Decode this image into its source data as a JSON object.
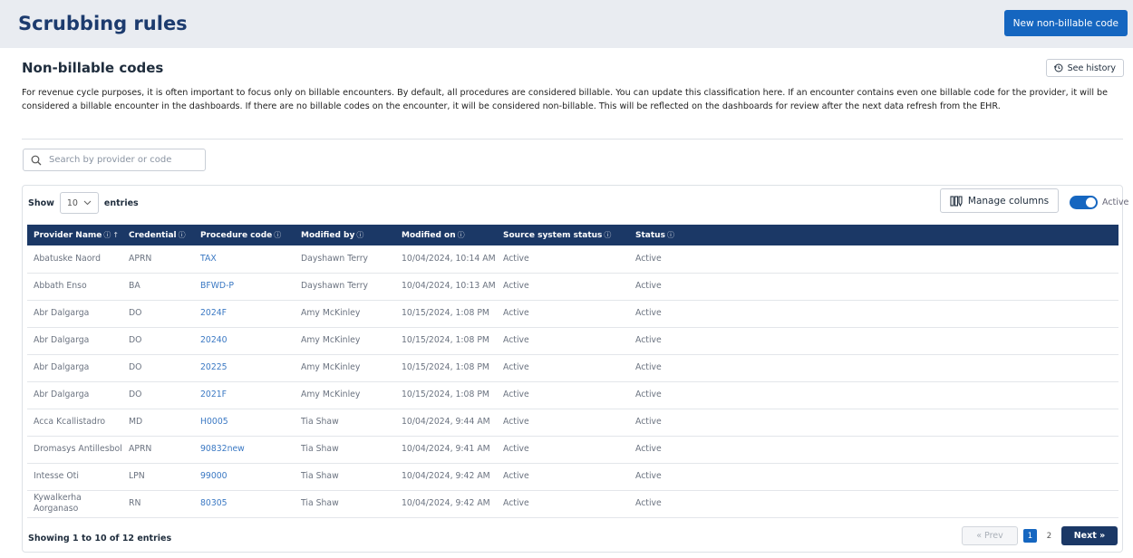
{
  "header": {
    "title": "Scrubbing rules",
    "new_button": "New non-billable code"
  },
  "section": {
    "title": "Non-billable codes",
    "history_button": "See history",
    "description": "For revenue cycle purposes, it is often important to focus only on billable encounters. By default, all procedures are considered billable. You can update this classification here. If an encounter contains even one billable code for the provider, it will be considered a billable encounter in the dashboards. If there are no billable codes on the encounter, it will be considered non-billable. This will be reflected on the dashboards for review after the next data refresh from the EHR."
  },
  "search": {
    "placeholder": "Search by provider or code"
  },
  "table_controls": {
    "show_label": "Show",
    "entries_value": "10",
    "entries_label": "entries",
    "manage_columns": "Manage columns",
    "toggle_label": "Active",
    "toggle_on": true
  },
  "columns": [
    "Provider Name",
    "Credential",
    "Procedure code",
    "Modified by",
    "Modified on",
    "Source system status",
    "Status"
  ],
  "rows": [
    [
      "Abatuske Naord",
      "APRN",
      "TAX",
      "Dayshawn Terry",
      "10/04/2024, 10:14 AM",
      "Active",
      "Active"
    ],
    [
      "Abbath Enso",
      "BA",
      "BFWD-P",
      "Dayshawn Terry",
      "10/04/2024, 10:13 AM",
      "Active",
      "Active"
    ],
    [
      "Abr Dalgarga",
      "DO",
      "2024F",
      "Amy McKinley",
      "10/15/2024, 1:08 PM",
      "Active",
      "Active"
    ],
    [
      "Abr Dalgarga",
      "DO",
      "20240",
      "Amy McKinley",
      "10/15/2024, 1:08 PM",
      "Active",
      "Active"
    ],
    [
      "Abr Dalgarga",
      "DO",
      "20225",
      "Amy McKinley",
      "10/15/2024, 1:08 PM",
      "Active",
      "Active"
    ],
    [
      "Abr Dalgarga",
      "DO",
      "2021F",
      "Amy McKinley",
      "10/15/2024, 1:08 PM",
      "Active",
      "Active"
    ],
    [
      "Acca Kcallistadro",
      "MD",
      "H0005",
      "Tia Shaw",
      "10/04/2024, 9:44 AM",
      "Active",
      "Active"
    ],
    [
      "Dromasys Antillesbol",
      "APRN",
      "90832new",
      "Tia Shaw",
      "10/04/2024, 9:41 AM",
      "Active",
      "Active"
    ],
    [
      "Intesse Oti",
      "LPN",
      "99000",
      "Tia Shaw",
      "10/04/2024, 9:42 AM",
      "Active",
      "Active"
    ],
    [
      "Kywalkerha Aorganaso",
      "RN",
      "80305",
      "Tia Shaw",
      "10/04/2024, 9:42 AM",
      "Active",
      "Active"
    ]
  ],
  "footer": {
    "showing": "Showing 1 to 10 of 12 entries",
    "prev": "Prev",
    "next": "Next",
    "pages": [
      "1",
      "2"
    ],
    "current_page": "1"
  },
  "colors": {
    "header_bg": "#1b3866",
    "primary": "#1566c0",
    "link": "#3a78c3"
  },
  "icons": {
    "search": "search-icon",
    "history": "history-icon",
    "sort": "sort-ascending-icon",
    "columns": "columns-icon"
  }
}
